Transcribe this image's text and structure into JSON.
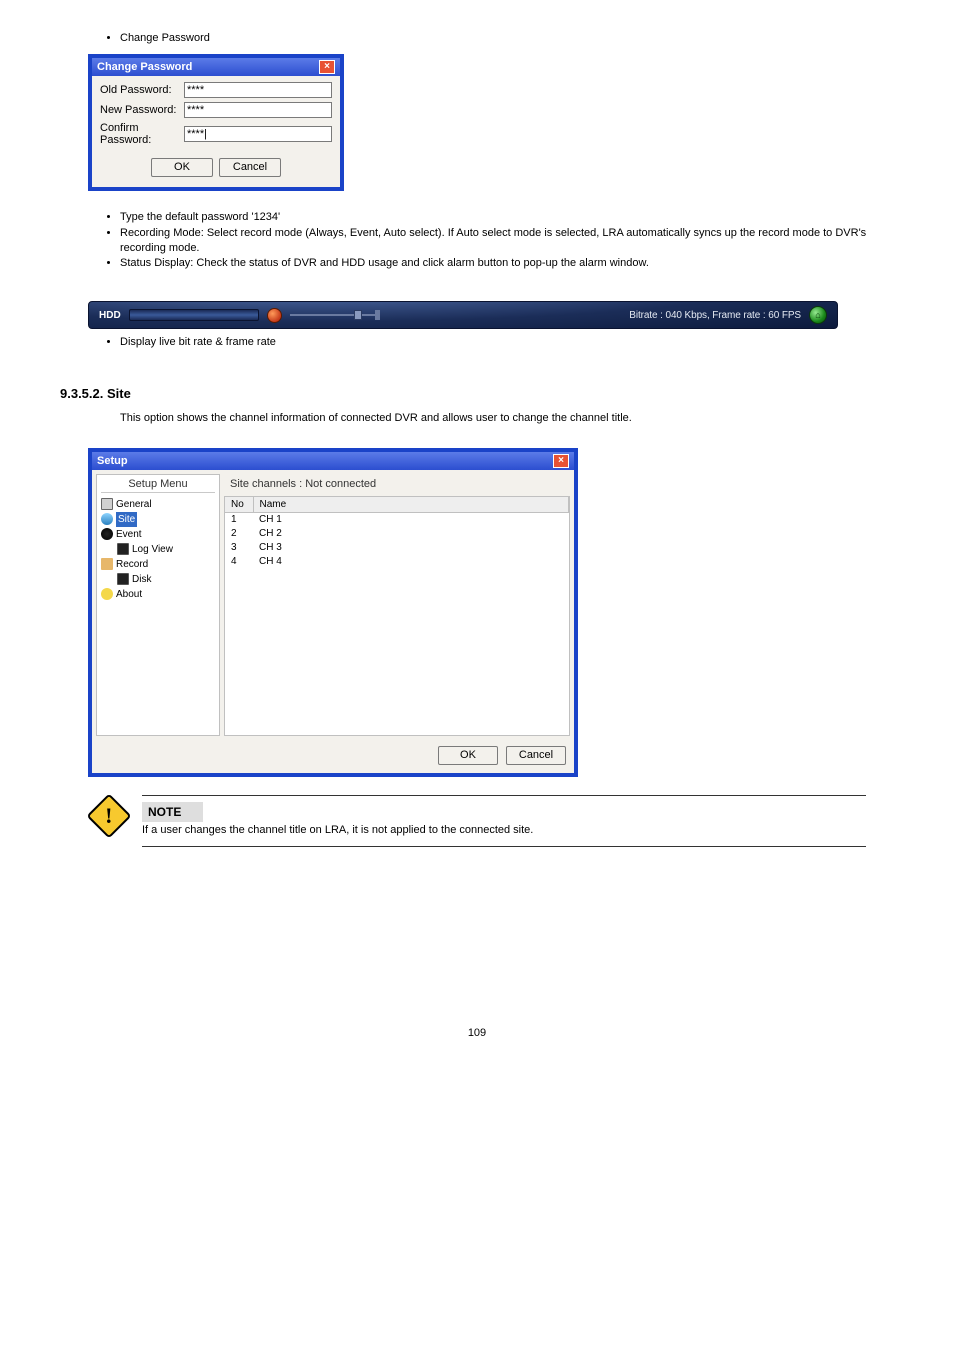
{
  "bullets_top": [
    "Change Password"
  ],
  "change_password": {
    "title": "Change Password",
    "old_label": "Old Password:",
    "new_label": "New Password:",
    "confirm_label": "Confirm Password:",
    "old_value": "****",
    "new_value": "****",
    "confirm_value": "****|",
    "ok": "OK",
    "cancel": "Cancel"
  },
  "bullets_mid": [
    "Type the default password '1234'",
    "Recording Mode: Select record mode (Always, Event, Auto select). If Auto select mode is selected, LRA automatically syncs up the record mode to DVR's recording mode.",
    "Status Display: Check the status of DVR and HDD usage and click alarm button to pop-up the alarm window."
  ],
  "statusbar": {
    "hdd_label": "HDD",
    "text": "Bitrate : 040 Kbps, Frame rate : 60 FPS",
    "indicator": "⌂"
  },
  "bullets_after_bar": [
    "Display live bit rate & frame rate"
  ],
  "site_heading": "9.3.5.2. Site",
  "site_para": "This option shows the channel information of connected DVR and allows user to change the channel title.",
  "setup": {
    "title": "Setup",
    "tree_header": "Setup Menu",
    "tree": {
      "general": "General",
      "site": "Site",
      "event": "Event",
      "log_view": "Log View",
      "record": "Record",
      "disk": "Disk",
      "about": "About"
    },
    "caption": "Site channels  : Not connected",
    "col_no": "No",
    "col_name": "Name",
    "rows": [
      {
        "no": "1",
        "name": "CH 1"
      },
      {
        "no": "2",
        "name": "CH 2"
      },
      {
        "no": "3",
        "name": "CH 3"
      },
      {
        "no": "4",
        "name": "CH 4"
      }
    ],
    "ok": "OK",
    "cancel": "Cancel"
  },
  "note": {
    "label": "NOTE",
    "text": "If a user changes the channel title on LRA, it is not applied to the connected site."
  },
  "page_num": "109"
}
